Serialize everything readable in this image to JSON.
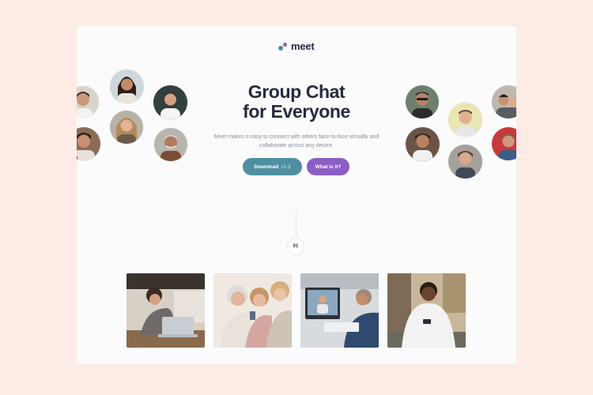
{
  "brand": {
    "name": "meet"
  },
  "hero": {
    "title_line1": "Group Chat",
    "title_line2": "for Everyone",
    "description": "Meet makes it easy to connect with others face-to-face virtually and collaborate across any device."
  },
  "actions": {
    "download_label": "Download",
    "download_version": "v1.3",
    "what_label": "What is it?"
  },
  "steps": {
    "current": "01"
  },
  "colors": {
    "page_background": "#fdebe6",
    "card_background": "#fbfbfc",
    "heading": "#262a3e",
    "accent_cyan": "#4e90a1",
    "accent_violet": "#8b5ec6"
  },
  "avatars_left": [
    "person-avatar",
    "person-avatar",
    "person-avatar",
    "person-avatar",
    "person-avatar",
    "person-avatar"
  ],
  "avatars_right": [
    "person-avatar",
    "person-avatar",
    "person-avatar",
    "person-avatar",
    "person-avatar",
    "person-avatar"
  ],
  "photos": [
    "woman-laptop-photo",
    "women-group-phone-photo",
    "man-video-call-photo",
    "man-phone-photo"
  ]
}
